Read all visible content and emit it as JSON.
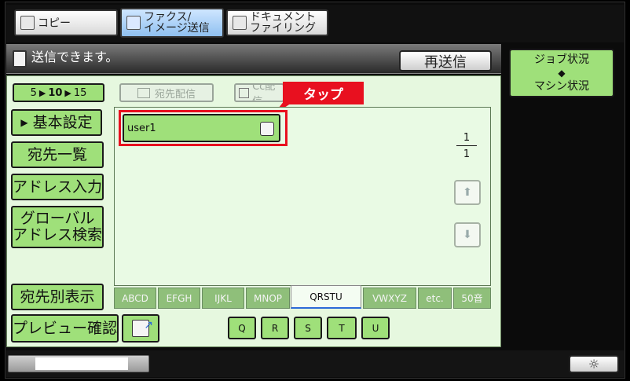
{
  "tabs": [
    {
      "label": "コピー"
    },
    {
      "label_line1": "ファクス/",
      "label_line2": "イメージ送信"
    },
    {
      "label_line1": "ドキュメント",
      "label_line2": "ファイリング"
    }
  ],
  "status": {
    "message": "送信できます。",
    "resend_label": "再送信"
  },
  "job_status": {
    "label_top": "ジョブ状況",
    "arrows": "◆",
    "label_bottom": "マシン状況"
  },
  "page_range": {
    "start": "5",
    "middle": "10",
    "end": "15"
  },
  "top_buttons": {
    "destination": "宛先配信",
    "cc": "Cc配信"
  },
  "callout": {
    "label": "タップ"
  },
  "sidebar": {
    "basic_settings": "基本設定",
    "address_list": "宛先一覧",
    "address_input": "アドレス入力",
    "global_search_line1": "グローバル",
    "global_search_line2": "アドレス検索",
    "by_destination": "宛先別表示",
    "preview": "プレビュー確認"
  },
  "address_entries": [
    {
      "name": "user1"
    }
  ],
  "pager": {
    "current": "1",
    "total": "1"
  },
  "alphabet_tabs": [
    "ABCD",
    "EFGH",
    "IJKL",
    "MNOP",
    "QRSTU",
    "VWXYZ",
    "etc.",
    "50音"
  ],
  "selected_alpha": "QRSTU",
  "letters": [
    "Q",
    "R",
    "S",
    "T",
    "U"
  ]
}
